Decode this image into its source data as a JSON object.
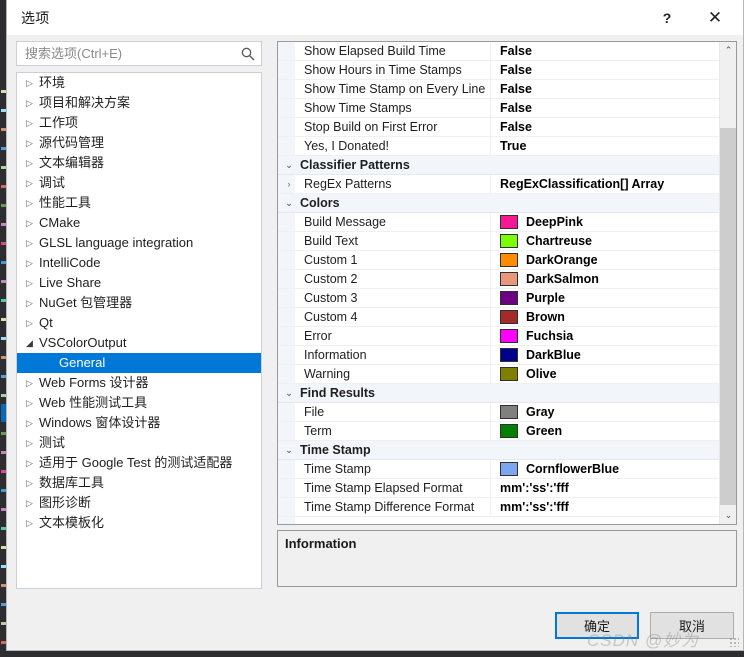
{
  "window": {
    "title": "选项",
    "help_label": "?",
    "close_label": "✕"
  },
  "search": {
    "placeholder": "搜索选项(Ctrl+E)",
    "value": "",
    "icon": "search-icon"
  },
  "sidebar": {
    "items": [
      {
        "label": "环境",
        "level": 1,
        "arrow": "▷",
        "expanded": false,
        "selected": false
      },
      {
        "label": "项目和解决方案",
        "level": 1,
        "arrow": "▷",
        "expanded": false,
        "selected": false
      },
      {
        "label": "工作项",
        "level": 1,
        "arrow": "▷",
        "expanded": false,
        "selected": false
      },
      {
        "label": "源代码管理",
        "level": 1,
        "arrow": "▷",
        "expanded": false,
        "selected": false
      },
      {
        "label": "文本编辑器",
        "level": 1,
        "arrow": "▷",
        "expanded": false,
        "selected": false
      },
      {
        "label": "调试",
        "level": 1,
        "arrow": "▷",
        "expanded": false,
        "selected": false
      },
      {
        "label": "性能工具",
        "level": 1,
        "arrow": "▷",
        "expanded": false,
        "selected": false
      },
      {
        "label": "CMake",
        "level": 1,
        "arrow": "▷",
        "expanded": false,
        "selected": false
      },
      {
        "label": "GLSL language integration",
        "level": 1,
        "arrow": "▷",
        "expanded": false,
        "selected": false
      },
      {
        "label": "IntelliCode",
        "level": 1,
        "arrow": "▷",
        "expanded": false,
        "selected": false
      },
      {
        "label": "Live Share",
        "level": 1,
        "arrow": "▷",
        "expanded": false,
        "selected": false
      },
      {
        "label": "NuGet 包管理器",
        "level": 1,
        "arrow": "▷",
        "expanded": false,
        "selected": false
      },
      {
        "label": "Qt",
        "level": 1,
        "arrow": "▷",
        "expanded": false,
        "selected": false
      },
      {
        "label": "VSColorOutput",
        "level": 1,
        "arrow": "◢",
        "expanded": true,
        "selected": false
      },
      {
        "label": "General",
        "level": 2,
        "arrow": "",
        "expanded": false,
        "selected": true
      },
      {
        "label": "Web Forms 设计器",
        "level": 1,
        "arrow": "▷",
        "expanded": false,
        "selected": false
      },
      {
        "label": "Web 性能测试工具",
        "level": 1,
        "arrow": "▷",
        "expanded": false,
        "selected": false
      },
      {
        "label": "Windows 窗体设计器",
        "level": 1,
        "arrow": "▷",
        "expanded": false,
        "selected": false
      },
      {
        "label": "测试",
        "level": 1,
        "arrow": "▷",
        "expanded": false,
        "selected": false
      },
      {
        "label": "适用于 Google Test 的测试适配器",
        "level": 1,
        "arrow": "▷",
        "expanded": false,
        "selected": false
      },
      {
        "label": "数据库工具",
        "level": 1,
        "arrow": "▷",
        "expanded": false,
        "selected": false
      },
      {
        "label": "图形诊断",
        "level": 1,
        "arrow": "▷",
        "expanded": false,
        "selected": false
      },
      {
        "label": "文本模板化",
        "level": 1,
        "arrow": "▷",
        "expanded": false,
        "selected": false
      }
    ]
  },
  "property_grid": {
    "rows": [
      {
        "kind": "property",
        "name": "Show Elapsed Build Time",
        "value": "False",
        "expander": "",
        "swatch": ""
      },
      {
        "kind": "property",
        "name": "Show Hours in Time Stamps",
        "value": "False",
        "expander": "",
        "swatch": ""
      },
      {
        "kind": "property",
        "name": "Show Time Stamp on Every Line",
        "value": "False",
        "expander": "",
        "swatch": ""
      },
      {
        "kind": "property",
        "name": "Show Time Stamps",
        "value": "False",
        "expander": "",
        "swatch": ""
      },
      {
        "kind": "property",
        "name": "Stop Build on First Error",
        "value": "False",
        "expander": "",
        "swatch": ""
      },
      {
        "kind": "property",
        "name": "Yes, I Donated!",
        "value": "True",
        "expander": "",
        "swatch": ""
      },
      {
        "kind": "category",
        "name": "Classifier Patterns",
        "value": "",
        "expander": "⌄",
        "swatch": ""
      },
      {
        "kind": "property",
        "name": "RegEx Patterns",
        "value": "RegExClassification[] Array",
        "expander": "›",
        "swatch": ""
      },
      {
        "kind": "category",
        "name": "Colors",
        "value": "",
        "expander": "⌄",
        "swatch": ""
      },
      {
        "kind": "property",
        "name": "Build Message",
        "value": "DeepPink",
        "expander": "",
        "swatch": "#F81894"
      },
      {
        "kind": "property",
        "name": "Build Text",
        "value": "Chartreuse",
        "expander": "",
        "swatch": "#7CFC00"
      },
      {
        "kind": "property",
        "name": "Custom 1",
        "value": "DarkOrange",
        "expander": "",
        "swatch": "#FF8C00"
      },
      {
        "kind": "property",
        "name": "Custom 2",
        "value": "DarkSalmon",
        "expander": "",
        "swatch": "#E9967A"
      },
      {
        "kind": "property",
        "name": "Custom 3",
        "value": "Purple",
        "expander": "",
        "swatch": "#6B0080"
      },
      {
        "kind": "property",
        "name": "Custom 4",
        "value": "Brown",
        "expander": "",
        "swatch": "#A52A2A"
      },
      {
        "kind": "property",
        "name": "Error",
        "value": "Fuchsia",
        "expander": "",
        "swatch": "#FF00FF"
      },
      {
        "kind": "property",
        "name": "Information",
        "value": "DarkBlue",
        "expander": "",
        "swatch": "#00008B"
      },
      {
        "kind": "property",
        "name": "Warning",
        "value": "Olive",
        "expander": "",
        "swatch": "#808000"
      },
      {
        "kind": "category",
        "name": "Find Results",
        "value": "",
        "expander": "⌄",
        "swatch": ""
      },
      {
        "kind": "property",
        "name": "File",
        "value": "Gray",
        "expander": "",
        "swatch": "#808080"
      },
      {
        "kind": "property",
        "name": "Term",
        "value": "Green",
        "expander": "",
        "swatch": "#008000"
      },
      {
        "kind": "category",
        "name": "Time Stamp",
        "value": "",
        "expander": "⌄",
        "swatch": ""
      },
      {
        "kind": "property",
        "name": "Time Stamp",
        "value": "CornflowerBlue",
        "expander": "",
        "swatch": "#7EA6F0"
      },
      {
        "kind": "property",
        "name": "Time Stamp  Elapsed Format",
        "value": "mm':'ss':'fff",
        "expander": "",
        "swatch": ""
      },
      {
        "kind": "property",
        "name": "Time Stamp Difference Format",
        "value": "mm':'ss':'fff",
        "expander": "",
        "swatch": ""
      }
    ],
    "scrollbar": {
      "up_arrow": "⌃",
      "down_arrow": "⌄"
    }
  },
  "info_panel": {
    "title": "Information",
    "body": ""
  },
  "footer": {
    "ok_label": "确定",
    "cancel_label": "取消"
  },
  "watermark": {
    "text": "CSDN @妙为"
  },
  "colors": {
    "accent": "#0078d7",
    "selection": "#0078d7",
    "category_bg": "#f2f5fa",
    "dialog_bg": "#f0f0f0"
  }
}
